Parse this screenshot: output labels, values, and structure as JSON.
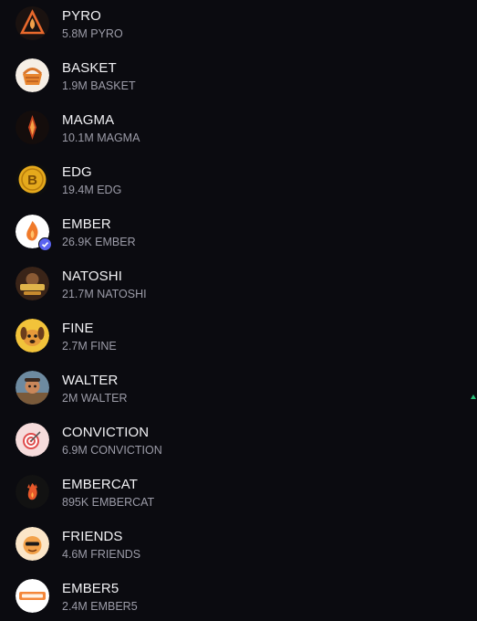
{
  "tokens": [
    {
      "name": "PYRO",
      "amount": "5.8M PYRO",
      "icon": "pyro-flame-triangle-icon"
    },
    {
      "name": "BASKET",
      "amount": "1.9M BASKET",
      "icon": "basket-icon"
    },
    {
      "name": "MAGMA",
      "amount": "10.1M MAGMA",
      "icon": "magma-crystal-icon"
    },
    {
      "name": "EDG",
      "amount": "19.4M EDG",
      "icon": "edg-coin-icon"
    },
    {
      "name": "EMBER",
      "amount": "26.9K EMBER",
      "icon": "ember-flame-icon",
      "verified": true
    },
    {
      "name": "NATOSHI",
      "amount": "21.7M NATOSHI",
      "icon": "natoshi-icon"
    },
    {
      "name": "FINE",
      "amount": "2.7M FINE",
      "icon": "fine-dog-icon"
    },
    {
      "name": "WALTER",
      "amount": "2M WALTER",
      "icon": "walter-character-icon"
    },
    {
      "name": "CONVICTION",
      "amount": "6.9M CONVICTION",
      "icon": "conviction-target-icon"
    },
    {
      "name": "EMBERCAT",
      "amount": "895K EMBERCAT",
      "icon": "embercat-flame-icon"
    },
    {
      "name": "FRIENDS",
      "amount": "4.6M FRIENDS",
      "icon": "friends-character-icon"
    },
    {
      "name": "EMBER5",
      "amount": "2.4M EMBER5",
      "icon": "ember5-logo-icon"
    }
  ],
  "colors": {
    "background": "#0b0b10",
    "primary_text": "#f2f2f5",
    "secondary_text": "#9c9ca8",
    "verified_badge": "#5a63f0",
    "indicator": "#28c07a"
  },
  "verified_icon": "verified-check-icon",
  "indicator_icon": "up-caret-icon"
}
